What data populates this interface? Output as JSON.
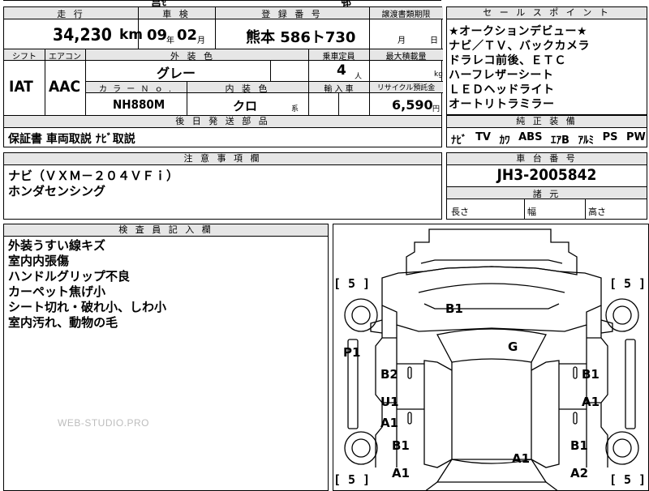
{
  "top_fragments": {
    "left": "莒ｾ",
    "right": "邨"
  },
  "headers": {
    "mileage": "走 行",
    "inspection": "車 検",
    "registration": "登 録 番 号",
    "transfer_deadline": "譲渡書類期限",
    "sales_points": "セ ー ル ス ポ イ ン ト",
    "shift": "シフト",
    "aircon": "エアコン",
    "exterior_color": "外 装 色",
    "capacity": "乗車定員",
    "max_load": "最大積載量",
    "color_no": "カ ラ ー Ｎ ｏ .",
    "interior_color": "内 装 色",
    "import_car": "輸 入 車",
    "recycle": "リサイクル預託金",
    "later_parts": "後 日 発 送 部 品",
    "genuine_equipment": "純 正 装 備",
    "notes": "注 意 事 項 欄",
    "chassis_number": "車 台 番 号",
    "specs": "諸 元",
    "inspector": "検 査 員 記 入 欄"
  },
  "vehicle": {
    "mileage_value": "34,230",
    "mileage_unit": "km",
    "inspection_year": "09",
    "inspection_year_unit": "年",
    "inspection_month": "02",
    "inspection_month_unit": "月",
    "registration": "熊本 586ト730",
    "transfer_month_unit": "月",
    "transfer_day_unit": "日",
    "shift": "IAT",
    "aircon": "AAC",
    "exterior_color": "グレー",
    "capacity": "4",
    "capacity_unit": "人",
    "max_load_unit": "kg",
    "color_no": "NH880M",
    "interior_color": "クロ",
    "interior_suffix": "系",
    "recycle_value": "6,590",
    "recycle_unit": "円",
    "later_parts": "保証書 車両取説 ﾅﾋﾞ取説",
    "chassis_number": "JH3-2005842",
    "spec_length": "長さ",
    "spec_width": "幅",
    "spec_height": "高さ"
  },
  "sales_points": [
    "★オークションデビュー★",
    "ナビ／ＴＶ、バックカメラ",
    "ドラレコ前後、ＥＴＣ",
    "ハーフレザーシート",
    "ＬＥＤヘッドライト",
    "オートリトラミラー"
  ],
  "genuine_equipment": [
    "ﾅﾋﾞ",
    "TV",
    "ｶﾜ",
    "ABS",
    "ｴｱB",
    "ｱﾙﾐ",
    "PS",
    "PW"
  ],
  "notes": [
    "ナビ（ＶＸＭ－２０４ＶＦｉ）",
    "ホンダセンシング"
  ],
  "inspector_notes": [
    "外装うすい線キズ",
    "室内内張傷",
    "ハンドルグリップ不良",
    "カーペット焦げ小",
    "シート切れ・破れ小、しわ小",
    "室内汚れ、動物の毛"
  ],
  "watermark": "WEB-STUDIO.PRO",
  "diagram": {
    "tyre_front_left": "[ 5 ]",
    "tyre_front_right": "[ 5 ]",
    "tyre_rear_left": "[ 5 ]",
    "tyre_rear_right": "[ 5 ]",
    "hood": "B1",
    "windshield": "G",
    "front_pillar_left": "P1",
    "fender_left": "B2",
    "fender_right": "B1",
    "door_front_left_u": "U1",
    "door_front_left_a": "A1",
    "door_front_right": "A1",
    "door_rear_left": "B1",
    "door_rear_right": "B1",
    "roof": "A1",
    "quarter_left": "A1",
    "quarter_right": "A2"
  }
}
